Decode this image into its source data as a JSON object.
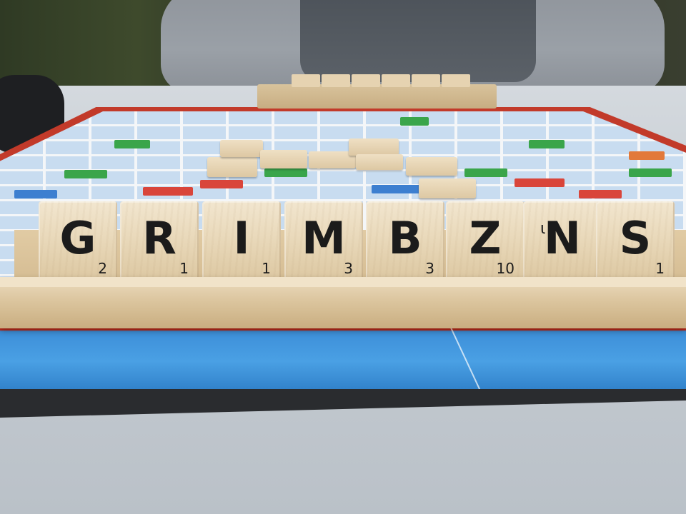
{
  "scene": {
    "description_label": "Scrabble tile rack",
    "rack_tiles": [
      {
        "letter": "G",
        "value": "2"
      },
      {
        "letter": "R",
        "value": "1"
      },
      {
        "letter": "I",
        "value": "1"
      },
      {
        "letter": "M",
        "value": "3"
      },
      {
        "letter": "B",
        "value": "3"
      },
      {
        "letter": "Z",
        "value": "10"
      },
      {
        "letter": "N",
        "value": "",
        "mark": "ι"
      },
      {
        "letter": "S",
        "value": "1"
      }
    ],
    "colors": {
      "board_red": "#c23a2a",
      "board_blue": "#4aa0e4",
      "tile_wood": "#e7d6b6",
      "premium_green": "#3aa54a",
      "premium_red": "#d9453a",
      "premium_blue": "#3d7fd0"
    }
  }
}
